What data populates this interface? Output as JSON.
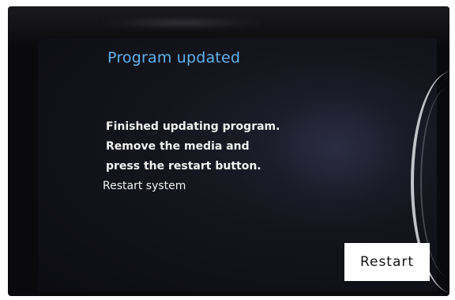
{
  "screen": {
    "title": "Program updated",
    "message_lines": [
      "Finished updating program.",
      "Remove the media and",
      "press the restart button.",
      "Restart system"
    ],
    "restart_label": "Restart"
  },
  "colors": {
    "title": "#5fb3ea",
    "message": "#f2f2f2",
    "screen_background": "#14141c",
    "button_background": "#ffffff",
    "button_text": "#111111"
  }
}
